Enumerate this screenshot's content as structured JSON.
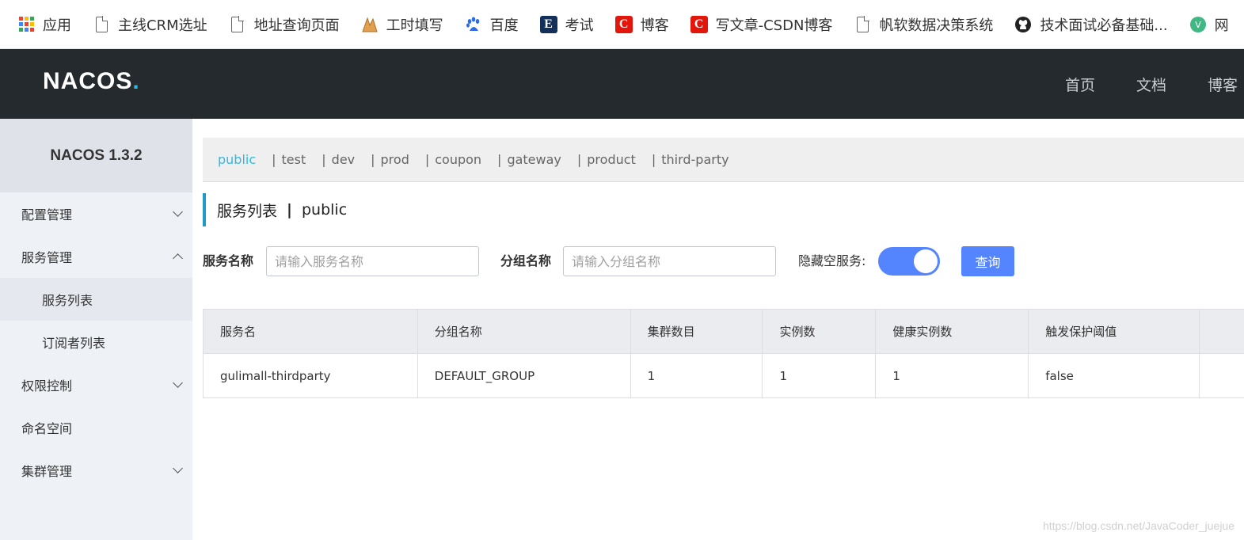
{
  "bookmarks": [
    {
      "label": "应用",
      "icon": "apps-grid-icon"
    },
    {
      "label": "主线CRM选址",
      "icon": "document-icon"
    },
    {
      "label": "地址查询页面",
      "icon": "document-icon"
    },
    {
      "label": "工时填写",
      "icon": "hours-app-icon"
    },
    {
      "label": "百度",
      "icon": "baidu-paw-icon"
    },
    {
      "label": "考试",
      "icon": "e-logo-icon"
    },
    {
      "label": "博客",
      "icon": "csdn-icon"
    },
    {
      "label": "写文章-CSDN博客",
      "icon": "csdn-icon"
    },
    {
      "label": "帆软数据决策系统",
      "icon": "document-icon"
    },
    {
      "label": "技术面试必备基础...",
      "icon": "github-icon"
    },
    {
      "label": "网",
      "icon": "vue-icon"
    }
  ],
  "header": {
    "logo": "NACOS",
    "logo_dot": ".",
    "nav": [
      "首页",
      "文档",
      "博客"
    ]
  },
  "sidebar": {
    "title": "NACOS 1.3.2",
    "items": [
      {
        "label": "配置管理"
      },
      {
        "label": "服务管理"
      },
      {
        "label": "服务列表"
      },
      {
        "label": "订阅者列表"
      },
      {
        "label": "权限控制"
      },
      {
        "label": "命名空间"
      },
      {
        "label": "集群管理"
      }
    ]
  },
  "namespaces": [
    "public",
    "test",
    "dev",
    "prod",
    "coupon",
    "gateway",
    "product",
    "third-party"
  ],
  "page": {
    "title": "服务列表",
    "separator": "|",
    "namespace": "public"
  },
  "filters": {
    "service_label": "服务名称",
    "service_placeholder": "请输入服务名称",
    "service_value": "",
    "group_label": "分组名称",
    "group_placeholder": "请输入分组名称",
    "group_value": "",
    "hide_empty_label": "隐藏空服务:",
    "hide_empty_on": true,
    "query_button": "查询"
  },
  "table": {
    "columns": [
      "服务名",
      "分组名称",
      "集群数目",
      "实例数",
      "健康实例数",
      "触发保护阈值",
      ""
    ],
    "rows": [
      [
        "gulimall-thirdparty",
        "DEFAULT_GROUP",
        "1",
        "1",
        "1",
        "false",
        ""
      ]
    ]
  },
  "watermark": "https://blog.csdn.net/JavaCoder_juejue",
  "colors": {
    "accent": "#2dbbe5",
    "primary_button": "#5584ff",
    "header_bg": "#252a2f",
    "sidebar_bg": "#eef1f6"
  }
}
